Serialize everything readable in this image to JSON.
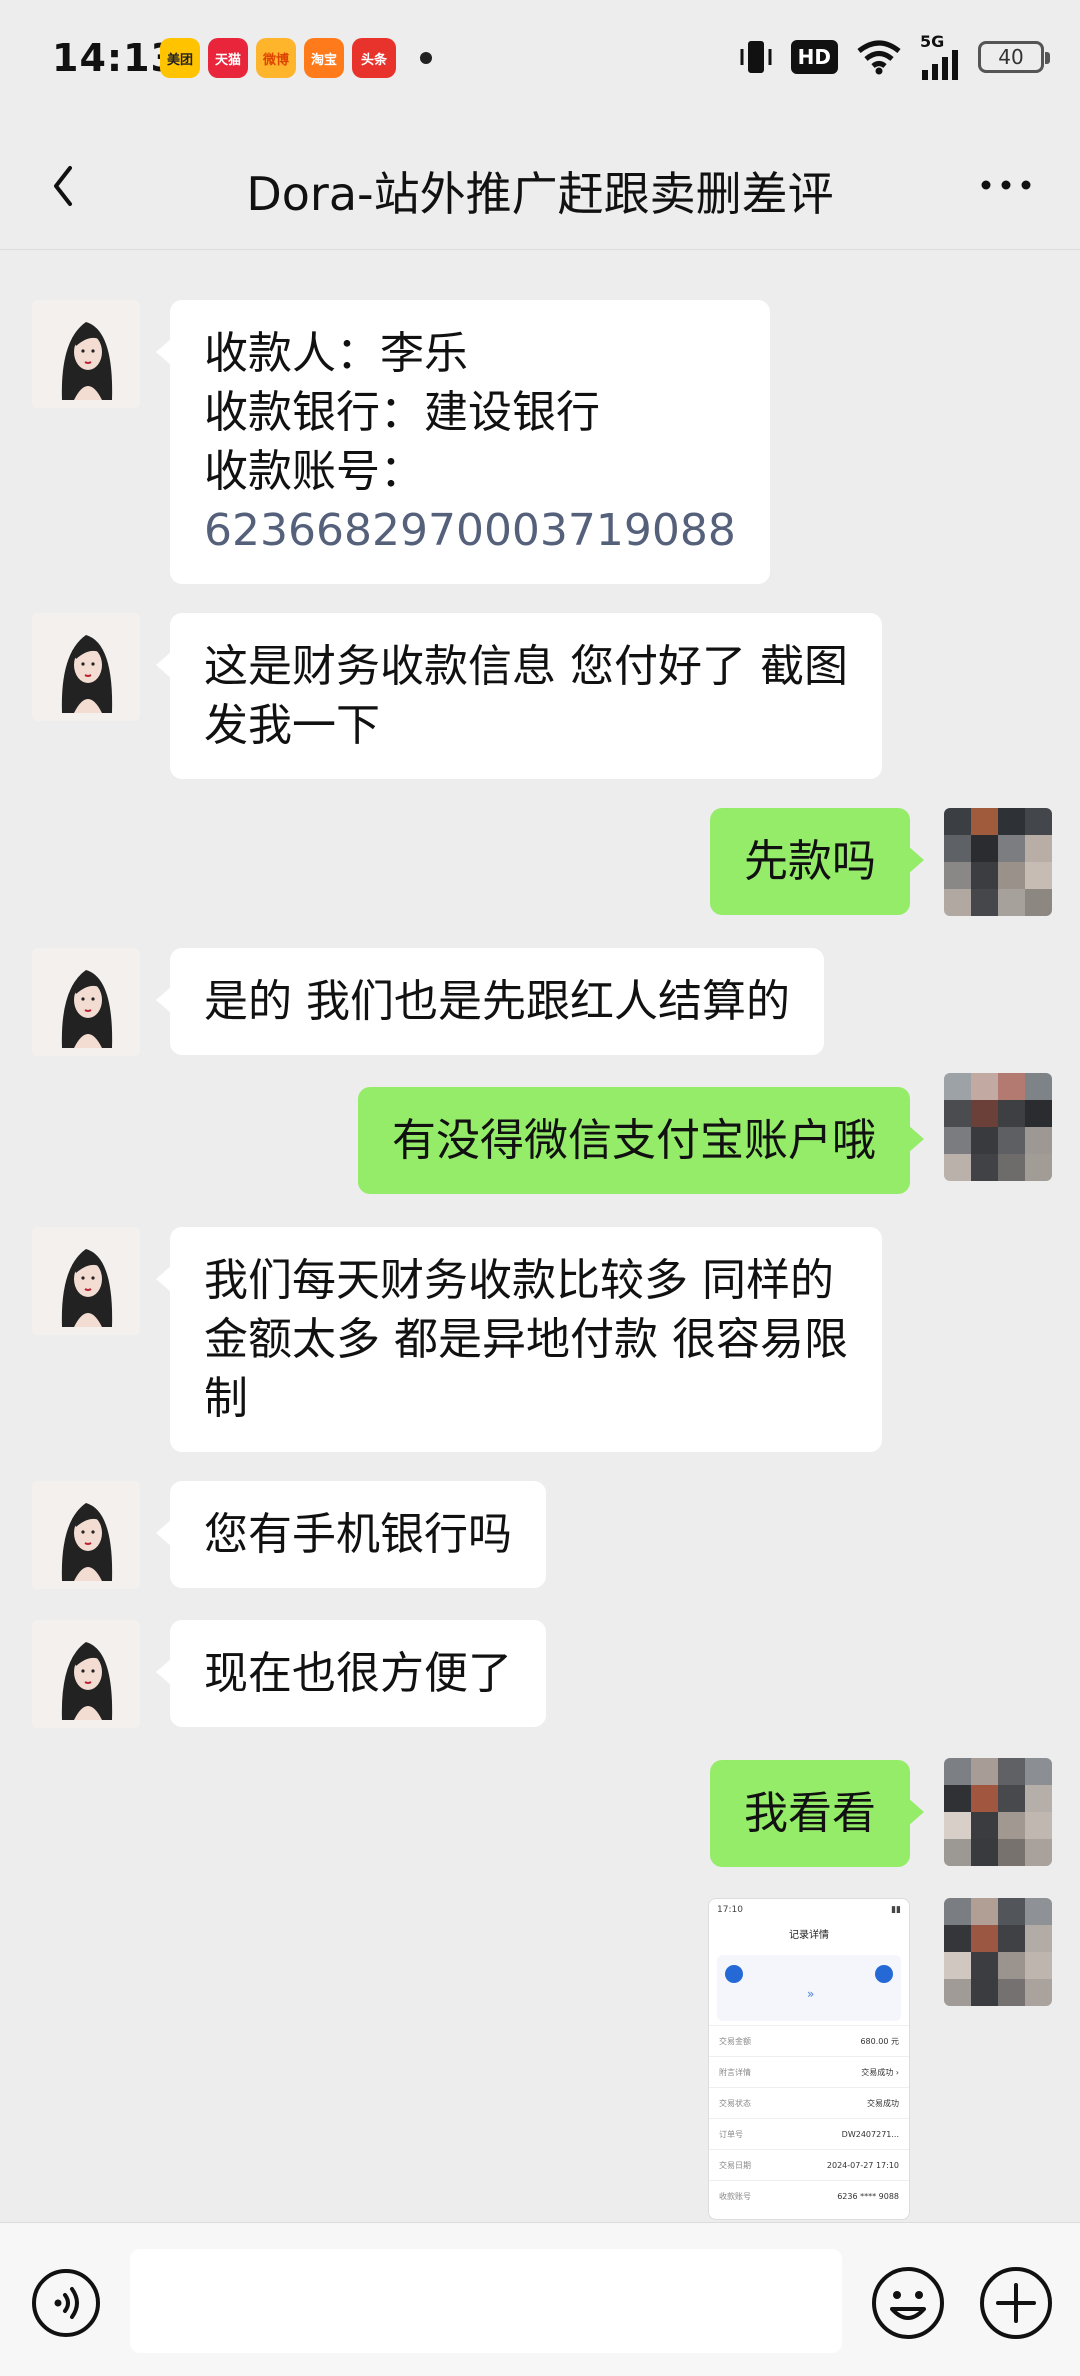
{
  "status_bar": {
    "time": "14:13",
    "app_badges": [
      "美团",
      "天猫",
      "微博",
      "淘宝",
      "头条"
    ],
    "hd": "HD",
    "network": "5G",
    "battery": "40"
  },
  "header": {
    "title": "Dora-站外推广赶跟卖删差评"
  },
  "messages": [
    {
      "side": "left",
      "lines": [
        "收款人：李乐",
        "收款银行：建设银行",
        "收款账号：",
        "6236682970003719088"
      ]
    },
    {
      "side": "left",
      "lines": [
        "这是财务收款信息  您付好了 截图",
        "发我一下"
      ]
    },
    {
      "side": "right",
      "lines": [
        "先款吗"
      ]
    },
    {
      "side": "left",
      "lines": [
        "是的 我们也是先跟红人结算的"
      ]
    },
    {
      "side": "right",
      "lines": [
        "有没得微信支付宝账户哦"
      ]
    },
    {
      "side": "left",
      "lines": [
        "我们每天财务收款比较多  同样的",
        "金额太多 都是异地付款 很容易限",
        "制"
      ]
    },
    {
      "side": "left",
      "lines": [
        "您有手机银行吗"
      ]
    },
    {
      "side": "left",
      "lines": [
        "现在也很方便了"
      ]
    },
    {
      "side": "right",
      "lines": [
        "我看看"
      ]
    }
  ],
  "image_message": {
    "time": "17:10",
    "title": "记录详情",
    "rows": [
      {
        "label": "交易金额",
        "value": "680.00 元"
      },
      {
        "label": "附言详情",
        "value": "交易成功 ›"
      },
      {
        "label": "交易状态",
        "value": "交易成功"
      },
      {
        "label": "订单号",
        "value": "DW2407271..."
      },
      {
        "label": "交易日期",
        "value": "2024-07-27 17:10"
      },
      {
        "label": "收款账号",
        "value": "6236 **** 9088"
      }
    ]
  },
  "input_bar": {
    "placeholder": ""
  },
  "colors": {
    "background": "#ededed",
    "bubble_self": "#95ec69",
    "bubble_other": "#ffffff",
    "account_number": "#55607a"
  }
}
